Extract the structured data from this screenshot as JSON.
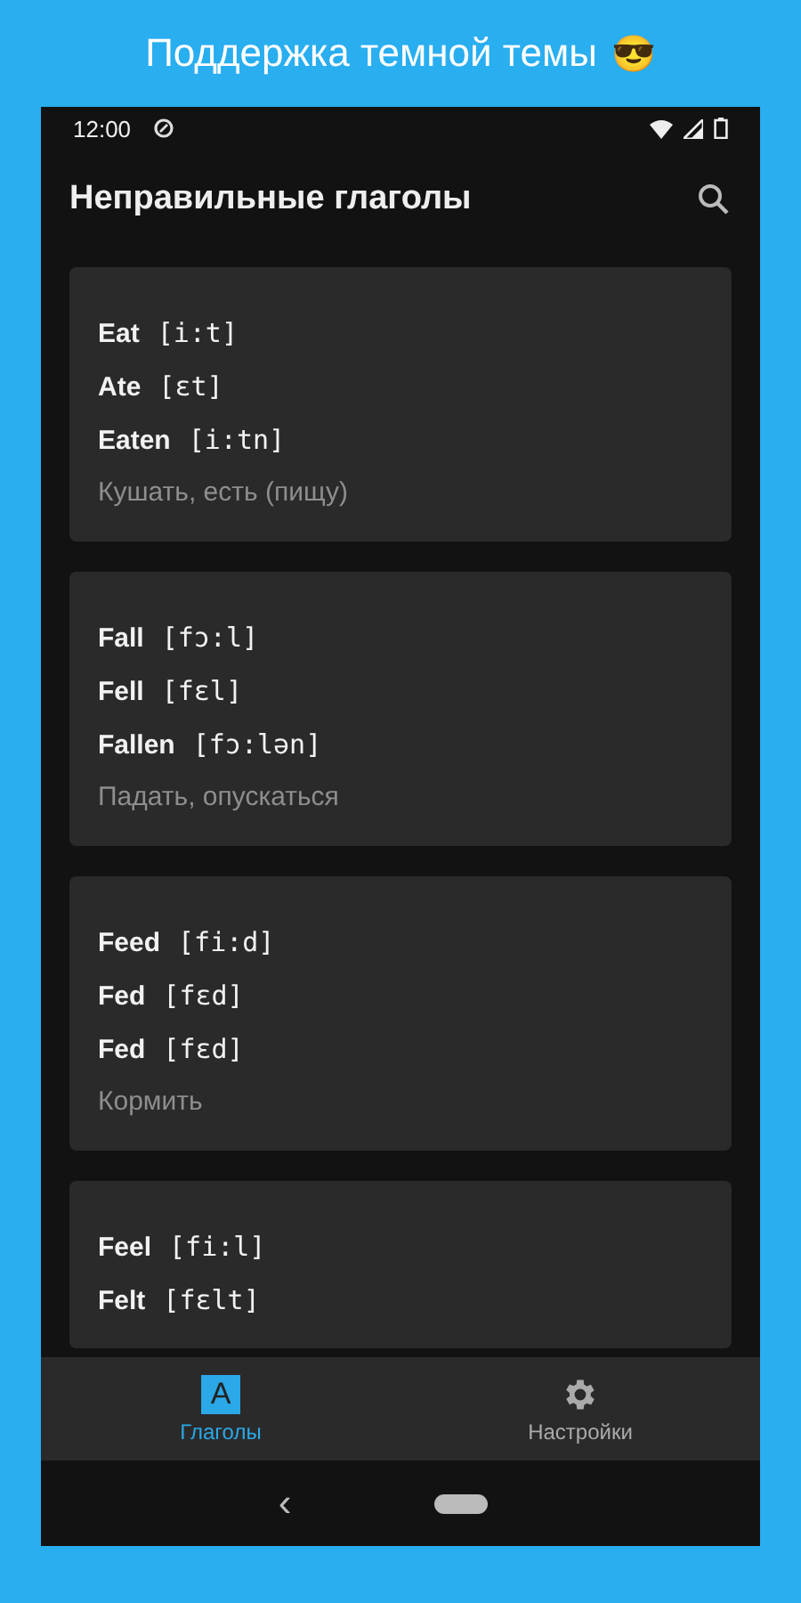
{
  "headline": {
    "text": "Поддержка темной темы",
    "emoji": "😎"
  },
  "status_bar": {
    "time": "12:00"
  },
  "app_bar": {
    "title": "Неправильные глаголы"
  },
  "verbs": [
    {
      "forms": [
        {
          "word": "Eat",
          "transcription": "[i:t]"
        },
        {
          "word": "Ate",
          "transcription": "[ɛt]"
        },
        {
          "word": "Eaten",
          "transcription": "[i:tn]"
        }
      ],
      "translation": "Кушать, есть (пищу)"
    },
    {
      "forms": [
        {
          "word": "Fall",
          "transcription": "[fɔ:l]"
        },
        {
          "word": "Fell",
          "transcription": "[fɛl]"
        },
        {
          "word": "Fallen",
          "transcription": "[fɔ:lən]"
        }
      ],
      "translation": "Падать, опускаться"
    },
    {
      "forms": [
        {
          "word": "Feed",
          "transcription": "[fi:d]"
        },
        {
          "word": "Fed",
          "transcription": "[fɛd]"
        },
        {
          "word": "Fed",
          "transcription": "[fɛd]"
        }
      ],
      "translation": "Кормить"
    },
    {
      "forms": [
        {
          "word": "Feel",
          "transcription": "[fi:l]"
        },
        {
          "word": "Felt",
          "transcription": "[fɛlt]"
        }
      ]
    }
  ],
  "bottom_nav": [
    {
      "kind": "letter",
      "glyph": "A",
      "label": "Глаголы",
      "selected": true
    },
    {
      "kind": "gear",
      "label": "Настройки",
      "selected": false
    }
  ],
  "system_nav": {
    "back": "‹"
  }
}
